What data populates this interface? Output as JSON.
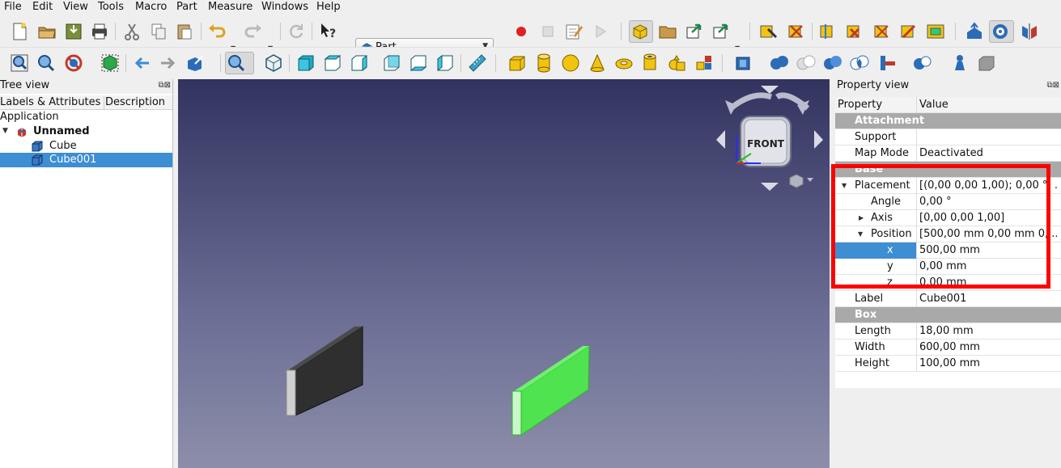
{
  "menu": [
    "File",
    "Edit",
    "View",
    "Tools",
    "Macro",
    "Part",
    "Measure",
    "Windows",
    "Help"
  ],
  "workbench": {
    "selected": "Part"
  },
  "tree": {
    "title": "Tree view",
    "columns": [
      "Labels & Attributes",
      "Description"
    ],
    "application": "Application",
    "document": "Unnamed",
    "items": [
      "Cube",
      "Cube001"
    ]
  },
  "property": {
    "title": "Property view",
    "columns": [
      "Property",
      "Value"
    ],
    "groups": {
      "attachment": "Attachment",
      "base": "Base",
      "box": "Box"
    },
    "rows": {
      "support": {
        "name": "Support",
        "value": ""
      },
      "map_mode": {
        "name": "Map Mode",
        "value": "Deactivated"
      },
      "placement": {
        "name": "Placement",
        "value": "[(0,00 0,00 1,00); 0,00 °; ..."
      },
      "angle": {
        "name": "Angle",
        "value": "0,00 °"
      },
      "axis": {
        "name": "Axis",
        "value": "[0,00 0,00 1,00]"
      },
      "position": {
        "name": "Position",
        "value": "[500,00 mm  0,00 mm  0,..."
      },
      "x": {
        "name": "x",
        "value": "500,00 mm"
      },
      "y": {
        "name": "y",
        "value": "0,00 mm"
      },
      "z": {
        "name": "z",
        "value": "0,00 mm"
      },
      "label": {
        "name": "Label",
        "value": "Cube001"
      },
      "length": {
        "name": "Length",
        "value": "18,00 mm"
      },
      "width": {
        "name": "Width",
        "value": "600,00 mm"
      },
      "height": {
        "name": "Height",
        "value": "100,00 mm"
      }
    }
  },
  "navcube": {
    "face": "FRONT"
  },
  "colors": {
    "selection": "#3d8ed3",
    "highlight_box": "#ff0000",
    "selected_object": "#4fe34f"
  }
}
